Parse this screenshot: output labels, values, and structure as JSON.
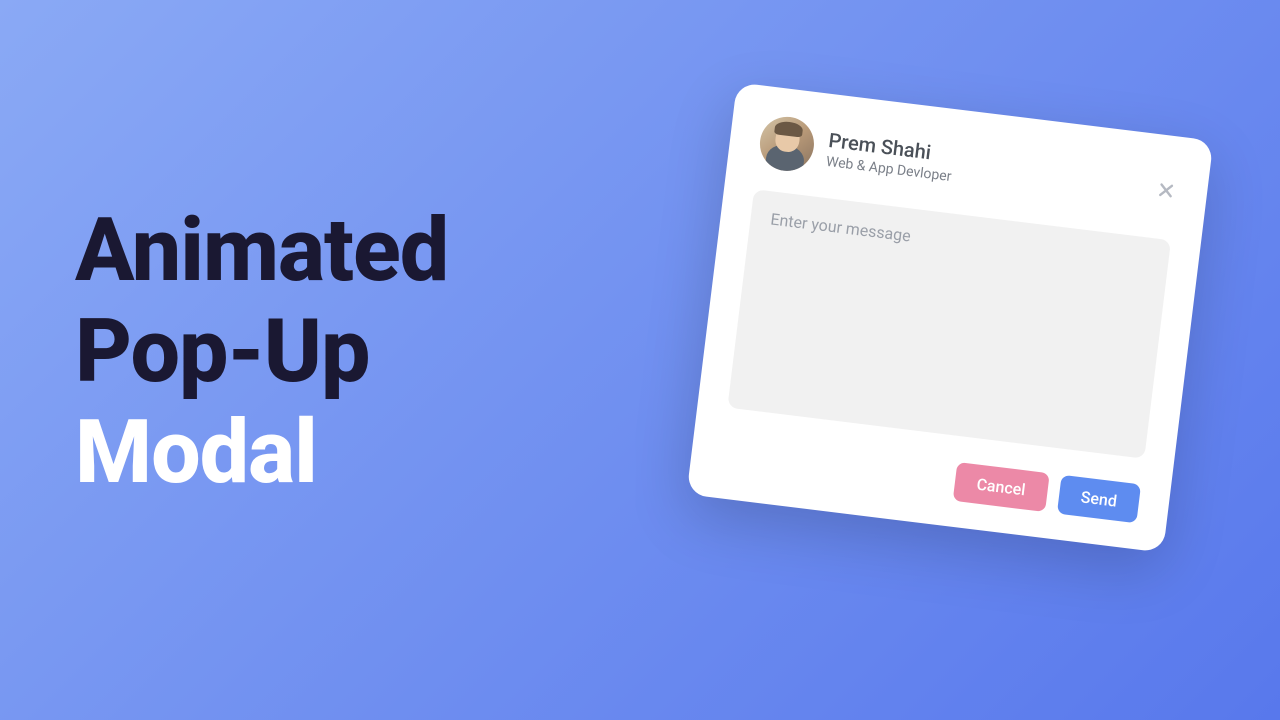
{
  "headline": {
    "line1": "Animated",
    "line2": "Pop-Up",
    "line3": "Modal"
  },
  "modal": {
    "user": {
      "name": "Prem Shahi",
      "role": "Web & App Devloper"
    },
    "message_placeholder": "Enter your message",
    "message_value": "",
    "cancel_label": "Cancel",
    "send_label": "Send"
  },
  "colors": {
    "bg_start": "#8aa9f5",
    "bg_end": "#5878ec",
    "dark_text": "#1a1832",
    "cancel_btn": "#ec89a7",
    "send_btn": "#5e8cf0"
  }
}
